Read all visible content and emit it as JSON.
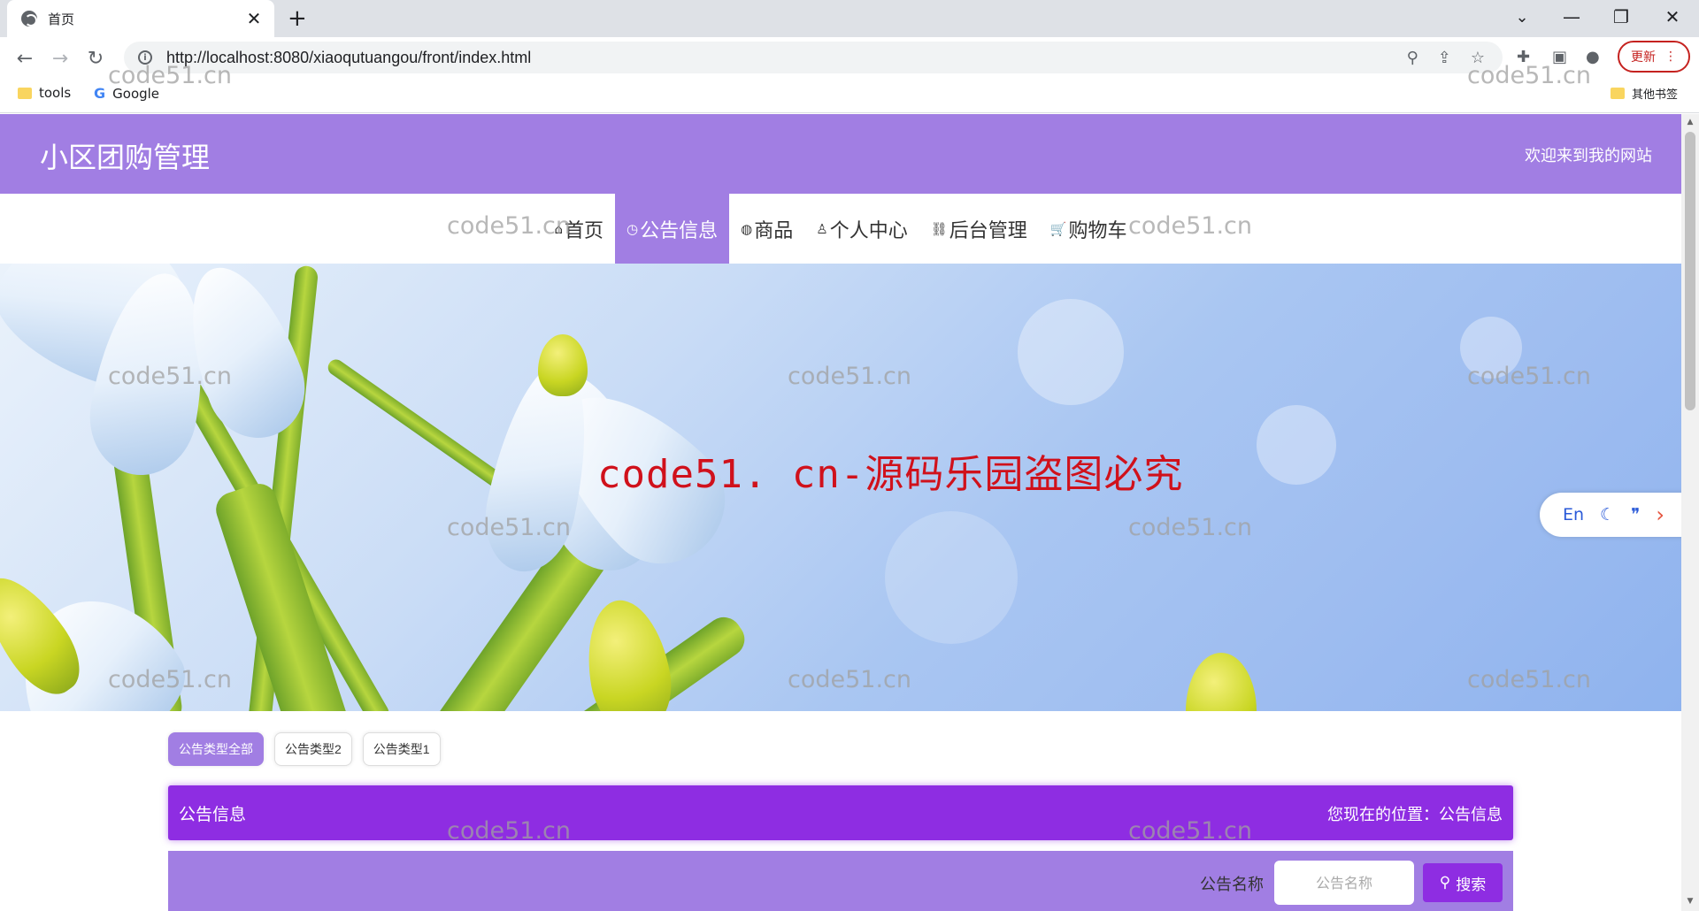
{
  "browser": {
    "tab_title": "首页",
    "tab_close": "✕",
    "new_tab": "+",
    "url": "http://localhost:8080/xiaoqutuangou/front/index.html",
    "update_label": "更新",
    "window_controls": {
      "minimize": "—",
      "maximize": "❐",
      "close": "✕"
    },
    "nav": {
      "back": "←",
      "forward": "→",
      "reload": "↻"
    },
    "bookmarks": [
      {
        "label": "tools",
        "icon": "folder-icon"
      },
      {
        "label": "Google",
        "icon": "google-icon"
      }
    ],
    "other_bookmarks": "其他书签",
    "icons": [
      "zoom-icon",
      "share-icon",
      "star-icon",
      "extensions-icon",
      "sidepanel-icon",
      "profile-icon"
    ]
  },
  "site": {
    "title": "小区团购管理",
    "welcome": "欢迎来到我的网站",
    "nav": [
      {
        "icon": "⌂",
        "label": "首页",
        "active": false
      },
      {
        "icon": "◷",
        "label": "公告信息",
        "active": true
      },
      {
        "icon": "◍",
        "label": "商品",
        "active": false
      },
      {
        "icon": "♙",
        "label": "个人中心",
        "active": false
      },
      {
        "icon": "⛓",
        "label": "后台管理",
        "active": false
      },
      {
        "icon": "🛒",
        "label": "购物车",
        "active": false
      }
    ],
    "accent": "#a17ee3",
    "accent_dark": "#8e2de2"
  },
  "side_widget": {
    "lang": "En",
    "icons": [
      "moon-icon",
      "quote-icon",
      "chevron-right-icon"
    ]
  },
  "filters": [
    {
      "label": "公告类型全部",
      "active": true
    },
    {
      "label": "公告类型2",
      "active": false
    },
    {
      "label": "公告类型1",
      "active": false
    }
  ],
  "titlebar": {
    "left": "公告信息",
    "right": "您现在的位置：公告信息"
  },
  "search": {
    "label": "公告名称",
    "placeholder": "公告名称",
    "button": "搜索"
  },
  "overlays": {
    "watermark": "code51.cn",
    "red_text": "code51. cn-源码乐园盗图必究"
  }
}
